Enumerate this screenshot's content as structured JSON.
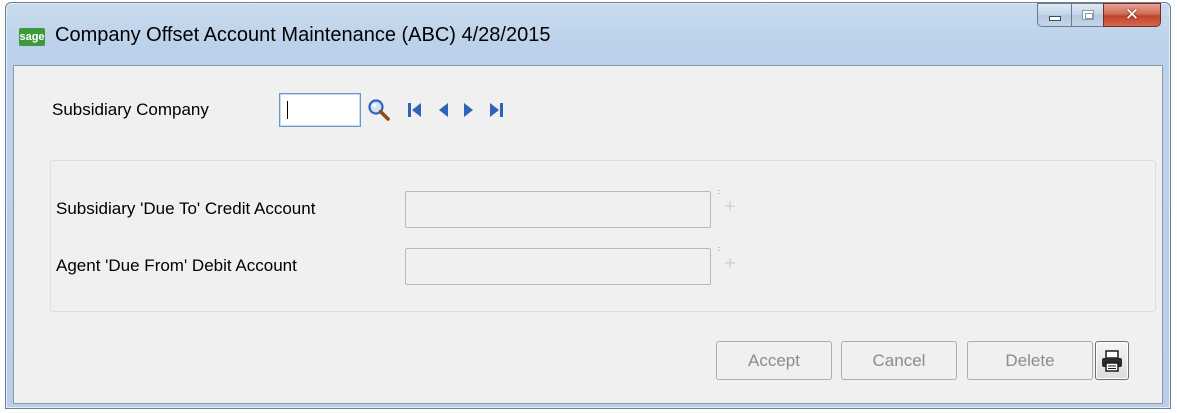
{
  "window": {
    "logo_text": "sage",
    "title": "Company Offset Account Maintenance (ABC) 4/28/2015"
  },
  "form": {
    "subsidiary_company_label": "Subsidiary Company",
    "subsidiary_company_value": "",
    "credit_account_label": "Subsidiary 'Due To' Credit Account",
    "credit_account_value": "",
    "debit_account_label": "Agent 'Due From' Debit Account",
    "debit_account_value": ""
  },
  "buttons": {
    "accept": "Accept",
    "cancel": "Cancel",
    "delete": "Delete"
  },
  "icons": {
    "search": "search-icon",
    "first": "first-record-icon",
    "previous": "previous-record-icon",
    "next": "next-record-icon",
    "last": "last-record-icon",
    "print": "printer-icon",
    "lookup": "lookup-icon"
  },
  "colors": {
    "nav_blue": "#2f63b8",
    "disabled_text": "#8b8b8b",
    "close_red": "#c2432a"
  }
}
